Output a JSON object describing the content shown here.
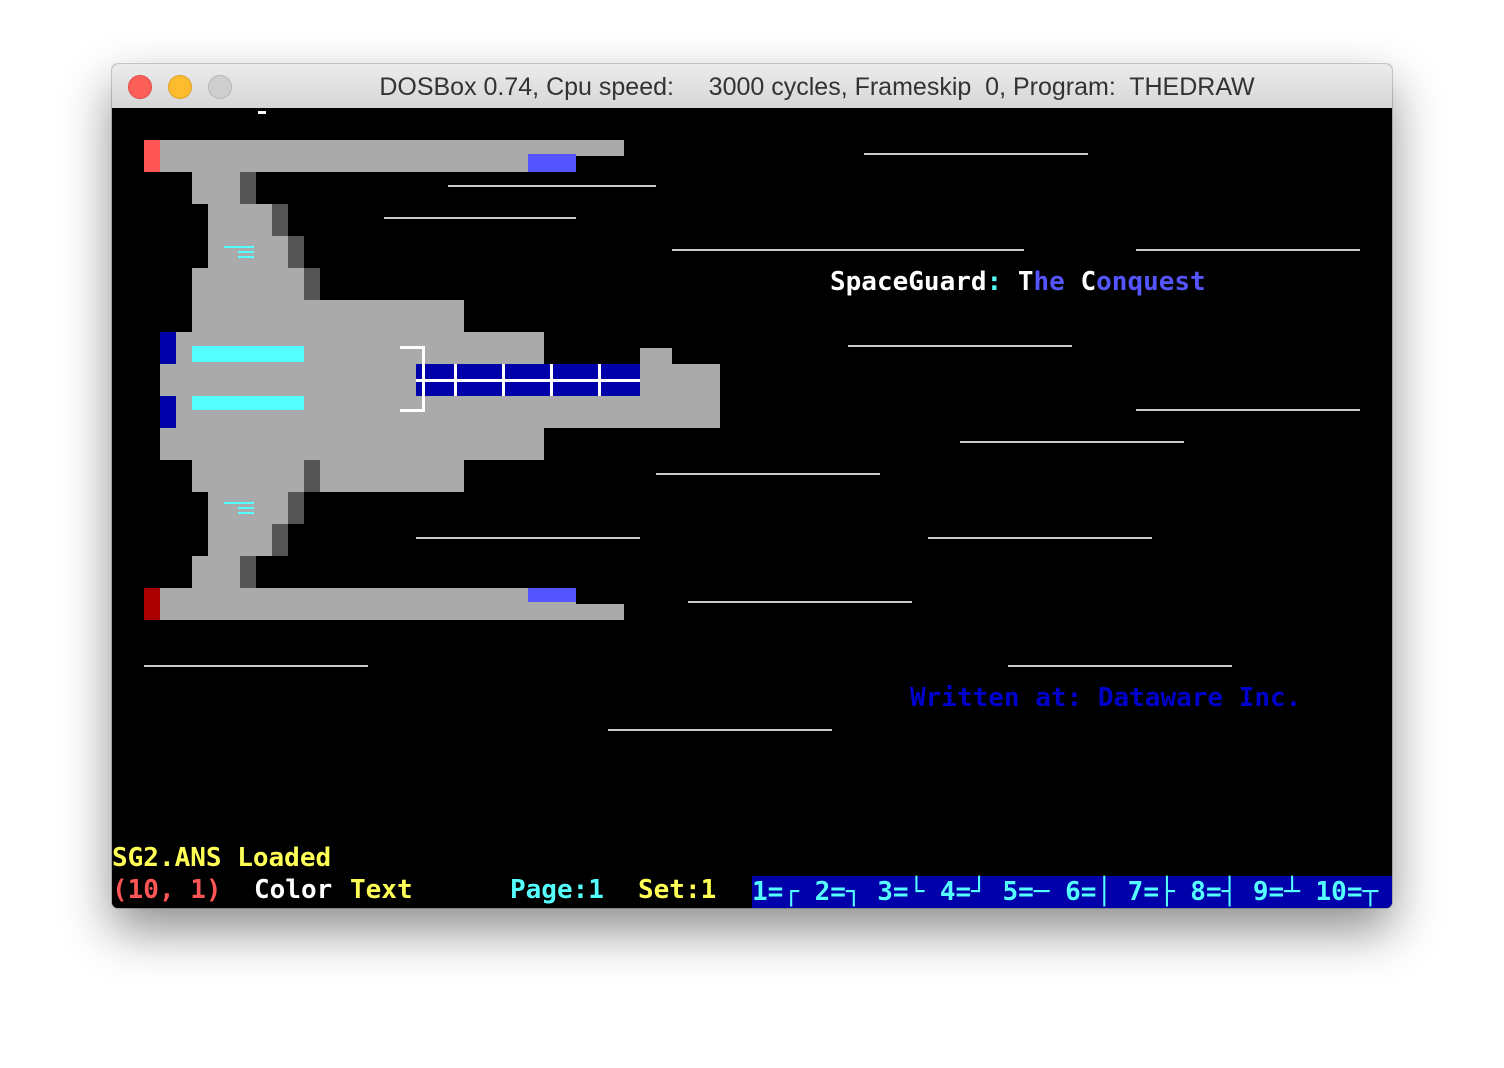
{
  "window": {
    "title": "DOSBox 0.74, Cpu speed:     3000 cycles, Frameskip  0, Program:  THEDRAW"
  },
  "screen": {
    "title_parts": {
      "space": "SpaceGuard",
      "colon": ":",
      "t": "T",
      "he": "he",
      "c": "C",
      "onquest": "onquest"
    },
    "credit": "Written at: Dataware Inc."
  },
  "status": {
    "file_message": "SG2.ANS Loaded",
    "cursor_pos": "(10, 1)",
    "mode_label": "Color",
    "mode_value": "Text",
    "page": "Page:1",
    "set": "Set:1",
    "char_set_hints": "1=┌ 2=┐ 3=└ 4=┘ 5=─ 6=│ 7=├ 8=┤ 9=┴ 10=┬"
  },
  "colors": {
    "screen_bg": "#000000",
    "ship_gray": "#aaaaaa",
    "ship_shadow": "#555555",
    "engine_cyan": "#55ffff",
    "hull_blue": "#0000aa",
    "light_blue": "#5555ff",
    "bright_red": "#ff5555",
    "dark_red": "#aa0000",
    "yellow": "#ffff55",
    "white": "#ffffff"
  }
}
